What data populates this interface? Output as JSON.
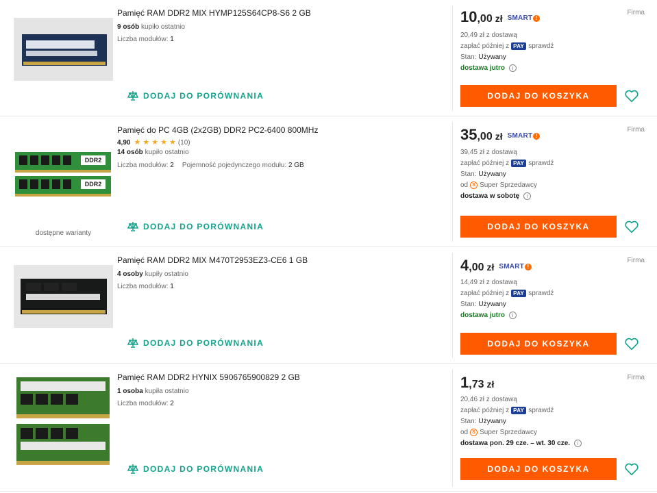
{
  "listings": [
    {
      "title": "Pamięć RAM DDR2 MIX HYMP125S64CP8-S6 2 GB",
      "buyers_count": "9 osób",
      "buyers_suffix": "kupiło ostatnio",
      "params": [
        {
          "label": "Liczba modułów:",
          "value": "1"
        }
      ],
      "compare_label": "DODAJ DO PORÓWNANIA",
      "price_int": "10",
      "price_frac": ",00",
      "currency": "zł",
      "smart_label": "SMART",
      "seller_type": "Firma",
      "delivery_price": "20,49 zł z dostawą",
      "pay_later_prefix": "zapłać później z",
      "pay_badge": "PAY",
      "pay_later_suffix": "sprawdź",
      "condition_label": "Stan:",
      "condition_value": "Używany",
      "delivery_text": "dostawa jutro",
      "cart_label": "DODAJ DO KOSZYKA"
    },
    {
      "title": "Pamięć do PC 4GB (2x2GB) DDR2 PC2-6400 800MHz",
      "rating_score": "4,90",
      "rating_count": "(10)",
      "rating_stars": 5,
      "buyers_count": "14 osób",
      "buyers_suffix": "kupiło ostatnio",
      "params": [
        {
          "label": "Liczba modułów:",
          "value": "2"
        },
        {
          "label": "Pojemność pojedynczego modułu:",
          "value": "2 GB"
        }
      ],
      "chip_label": "DDR2",
      "variants_note": "dostępne warianty",
      "compare_label": "DODAJ DO PORÓWNANIA",
      "price_int": "35",
      "price_frac": ",00",
      "currency": "zł",
      "smart_label": "SMART",
      "seller_type": "Firma",
      "delivery_price": "39,45 zł z dostawą",
      "pay_later_prefix": "zapłać później z",
      "pay_badge": "PAY",
      "pay_later_suffix": "sprawdź",
      "condition_label": "Stan:",
      "condition_value": "Używany",
      "seller_prefix": "od",
      "seller_badge": "Super Sprzedawcy",
      "delivery_text": "dostawa w sobotę",
      "cart_label": "DODAJ DO KOSZYKA"
    },
    {
      "title": "Pamięć RAM DDR2 MIX M470T2953EZ3-CE6 1 GB",
      "buyers_count": "4 osoby",
      "buyers_suffix": "kupiły ostatnio",
      "params": [
        {
          "label": "Liczba modułów:",
          "value": "1"
        }
      ],
      "compare_label": "DODAJ DO PORÓWNANIA",
      "price_int": "4",
      "price_frac": ",00",
      "currency": "zł",
      "smart_label": "SMART",
      "seller_type": "Firma",
      "delivery_price": "14,49 zł z dostawą",
      "pay_later_prefix": "zapłać później z",
      "pay_badge": "PAY",
      "pay_later_suffix": "sprawdź",
      "condition_label": "Stan:",
      "condition_value": "Używany",
      "delivery_text": "dostawa jutro",
      "cart_label": "DODAJ DO KOSZYKA"
    },
    {
      "title": "Pamięć RAM DDR2 HYNIX 5906765900829 2 GB",
      "buyers_count": "1 osoba",
      "buyers_suffix": "kupiła ostatnio",
      "params": [
        {
          "label": "Liczba modułów:",
          "value": "2"
        }
      ],
      "compare_label": "DODAJ DO PORÓWNANIA",
      "price_int": "1",
      "price_frac": ",73",
      "currency": "zł",
      "seller_type": "Firma",
      "delivery_price": "20,46 zł z dostawą",
      "pay_later_prefix": "zapłać później z",
      "pay_badge": "PAY",
      "pay_later_suffix": "sprawdź",
      "condition_label": "Stan:",
      "condition_value": "Używany",
      "seller_prefix": "od",
      "seller_badge": "Super Sprzedawcy",
      "delivery_text": "dostawa pon. 29 cze. – wt. 30 cze.",
      "cart_label": "DODAJ DO KOSZYKA"
    }
  ],
  "colors": {
    "accent_orange": "#ff5a00",
    "compare_teal": "#14a38b",
    "delivery_green": "#1a7a23",
    "pay_blue": "#1c3f94",
    "star_gold": "#f5a623"
  },
  "icons": [
    "compare-icon",
    "heart-icon",
    "info-icon",
    "smart-badge-icon",
    "super-seller-icon",
    "star-icon"
  ]
}
